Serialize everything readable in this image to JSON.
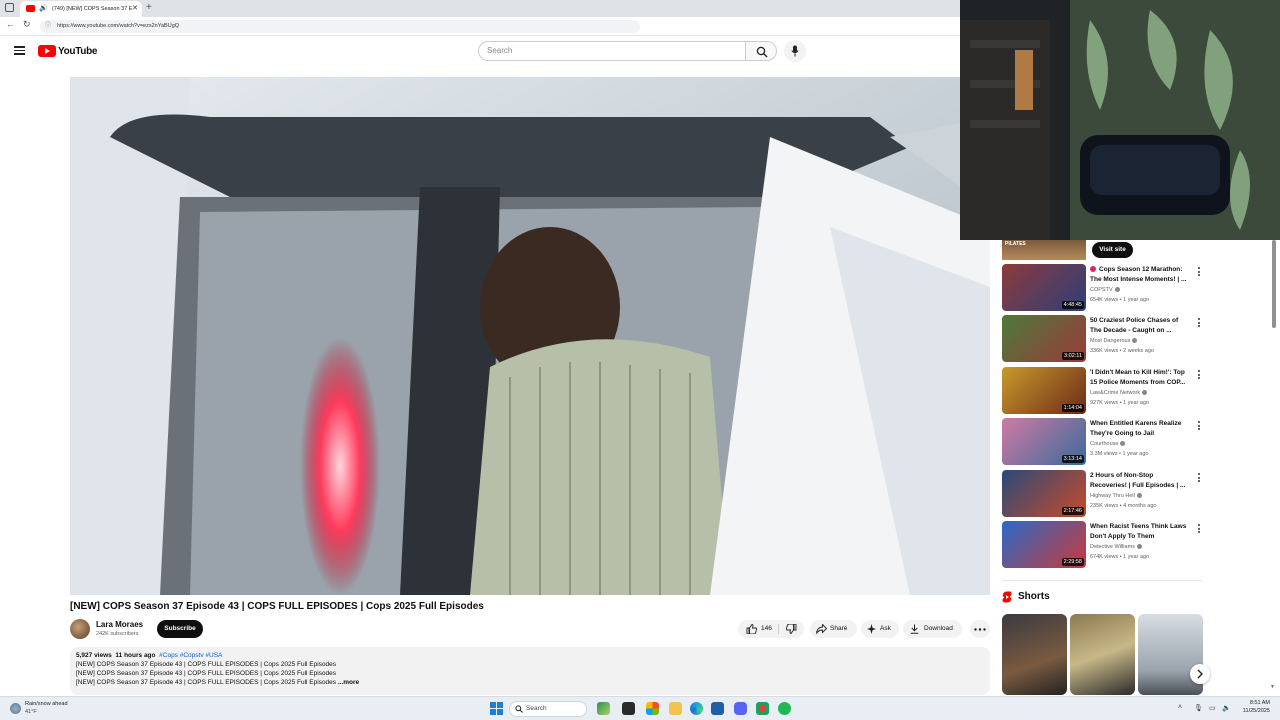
{
  "browser": {
    "tab_title": "(749) [NEW] COPS Season 37 E",
    "url": "https://www.youtube.com/watch?v=ezs2nYaBUgQ"
  },
  "header": {
    "logo_text": "YouTube",
    "search_placeholder": "Search"
  },
  "video": {
    "title": "[NEW] COPS Season 37 Episode 43 | COPS FULL EPISODES | Cops 2025 Full Episodes",
    "channel": "Lara Moraes",
    "subscribers": "242K subscribers",
    "subscribe_label": "Subscribe",
    "likes": "146",
    "share_label": "Share",
    "ask_label": "Ask",
    "download_label": "Download"
  },
  "description": {
    "views": "5,927 views",
    "age": "11 hours ago",
    "tags": "#Cops #Copstv #USA",
    "lines": [
      "[NEW] COPS Season 37 Episode 43 | COPS FULL EPISODES | Cops 2025 Full Episodes",
      "[NEW] COPS Season 37 Episode 43 | COPS FULL EPISODES | Cops 2025 Full Episodes",
      "[NEW] COPS Season 37 Episode 43 | COPS FULL EPISODES | Cops 2025 Full Episodes"
    ],
    "more_label": "...more"
  },
  "sidebar": {
    "ad_label": "PILATES",
    "visit_label": "Visit site",
    "recommendations": [
      {
        "title": "Cops Season 12 Marathon: The Most Intense Moments! | ...",
        "channel": "COPSTV",
        "meta": "654K views • 1 year ago",
        "duration": "4:48:45",
        "thumb_color_a": "#8c3b3b",
        "thumb_color_b": "#2d3f7a"
      },
      {
        "title": "50 Craziest Police Chases of The Decade - Caught on ...",
        "channel": "Most Dangerous",
        "meta": "336K views • 2 weeks ago",
        "duration": "3:02:11",
        "thumb_color_a": "#4c7a3a",
        "thumb_color_b": "#9b3a3a"
      },
      {
        "title": "'I Didn't Mean to Kill Him!': Top 15 Police Moments from COP...",
        "channel": "Law&Crime Network",
        "meta": "927K views • 1 year ago",
        "duration": "1:14:04",
        "thumb_color_a": "#c89b2a",
        "thumb_color_b": "#6d2a1a"
      },
      {
        "title": "When Entitled Karens Realize They're Going to Jail",
        "channel": "Courthouse",
        "meta": "3.3M views • 1 year ago",
        "duration": "3:13:14",
        "thumb_color_a": "#d07aa5",
        "thumb_color_b": "#3a6a9a"
      },
      {
        "title": "2 Hours of Non-Stop Recoveries! | Full Episodes | ...",
        "channel": "Highway Thru Hell",
        "meta": "235K views • 4 months ago",
        "duration": "2:17:46",
        "thumb_color_a": "#2a4a7a",
        "thumb_color_b": "#c84a2a"
      },
      {
        "title": "When Racist Teens Think Laws Don't Apply To Them",
        "channel": "Detective Williams",
        "meta": "674K views • 1 year ago",
        "duration": "2:29:58",
        "thumb_color_a": "#2a6ac8",
        "thumb_color_b": "#c83a3a"
      }
    ],
    "shorts_label": "Shorts"
  },
  "taskbar": {
    "weather_line1": "Rain/snow ahead",
    "weather_line2": "41°F",
    "search_label": "Search",
    "time": "8:51 AM",
    "date": "11/25/2025"
  },
  "colors": {
    "youtube_red": "#ff0000",
    "link_blue": "#065fd4",
    "text_primary": "#0f0f0f",
    "text_secondary": "#606060"
  }
}
